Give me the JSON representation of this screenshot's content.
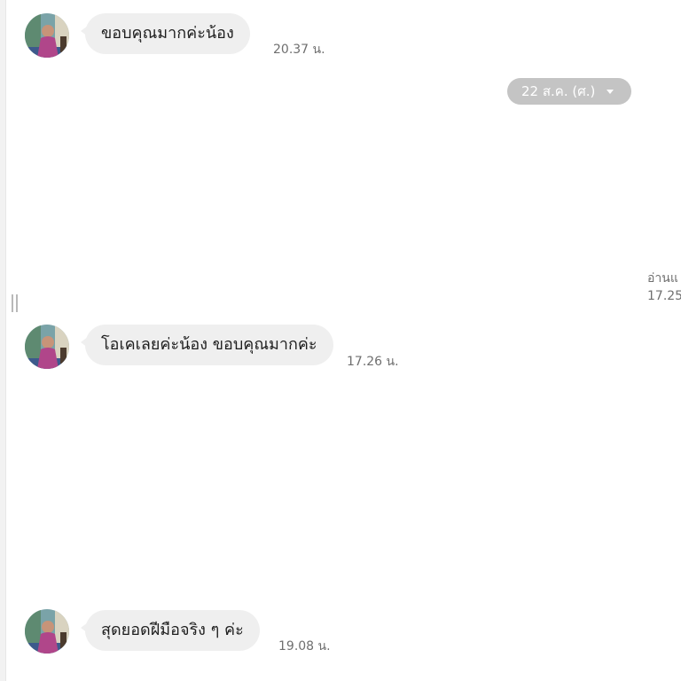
{
  "date_separator": {
    "label": "22 ส.ค. (ศ.)"
  },
  "read_receipt": {
    "status": "อ่านแ",
    "time": "17.25"
  },
  "messages": [
    {
      "text": "ขอบคุณมากค่ะน้อง",
      "time": "20.37 น."
    },
    {
      "text": "โอเคเลยค่ะน้อง ขอบคุณมากค่ะ",
      "time": "17.26 น."
    },
    {
      "text": "สุดยอดฝีมือจริง ๆ  ค่ะ",
      "time": "19.08 น."
    }
  ],
  "colors": {
    "bubble": "#efefef",
    "date_pill": "#c4c4c4",
    "timestamp": "#6f6f6f"
  }
}
